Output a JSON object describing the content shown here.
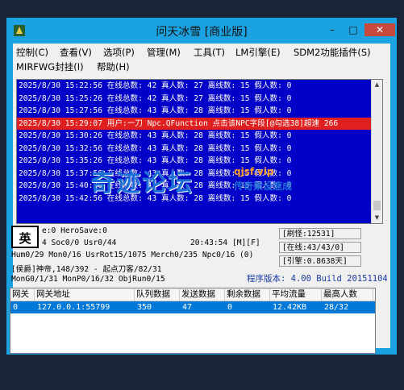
{
  "window": {
    "title": "问天冰雪 [商业版]",
    "minimize": "–",
    "maximize": "□",
    "close": "✕"
  },
  "menu": {
    "items": [
      "控制(C)",
      "查看(V)",
      "选项(P)",
      "管理(M)",
      "工具(T)",
      "LM引擎(E)",
      "SDM2功能插件(S)",
      "MIRFWG封挂(I)",
      "帮助(H)"
    ]
  },
  "log": {
    "lines": [
      "2025/8/30 15:22:56 在线总数: 42 真人数: 27 离线数: 15 假人数: 0",
      "2025/8/30 15:25:26 在线总数: 42 真人数: 27 离线数: 15 假人数: 0",
      "2025/8/30 15:27:56 在线总数: 43 真人数: 28 离线数: 15 假人数: 0",
      "2025/8/30 15:29:07 用户:一刀 Npc.QFunction 点击该NPC字段[@勾选38]超速 266",
      "2025/8/30 15:30:26 在线总数: 43 真人数: 28 离线数: 15 假人数: 0",
      "2025/8/30 15:32:56 在线总数: 43 真人数: 28 离线数: 15 假人数: 0",
      "2025/8/30 15:35:26 在线总数: 43 真人数: 28 离线数: 15 假人数: 0",
      "2025/8/30 15:37:56 在线总数: 43 真人数: 28 离线数: 15 假人数: 0",
      "2025/8/30 15:40:26 在线总数: 43 真人数: 28 离线数: 15 假人数: 0",
      "2025/8/30 15:42:56 在线总数: 43 真人数: 28 离线数: 15 假人数: 0"
    ]
  },
  "watermark": {
    "main": "奇迹论坛",
    "url": "qjsf.vip",
    "sub": "传奇架设速成"
  },
  "ime": "英",
  "status": {
    "line1": "e:0 HeroSave:0",
    "line2": "4 Soc0/0 Usr0/44",
    "time": "20:43:54 [M][F]",
    "line3": "Hum0/29 Mon0/16 UsrRot15/1075 Merch0/235 Npc0/16 (0)",
    "line4": "[侯爵]神帝,148/392 - 起点刀客/82/31",
    "line5": "MonG0/1/31 MonP0/16/32 ObjRun0/15"
  },
  "right_boxes": {
    "refresh": "[刷怪:12531]",
    "online": "[在线:43/43/0]",
    "engine": "[引擎:0.8638天]"
  },
  "version": "程序版本: 4.00 Build 20151104",
  "table": {
    "headers": [
      "网关",
      "网关地址",
      "队列数据",
      "发送数据",
      "剩余数据",
      "平均流量",
      "最高人数"
    ],
    "rows": [
      [
        "0",
        "127.0.0.1:55799",
        "350",
        "47",
        "0",
        "12.42KB",
        "28/32"
      ]
    ]
  },
  "colors": {
    "titlebar": "#1aa3e0",
    "log_bg": "#0000c8",
    "highlight": "#e0201e",
    "selected_row": "#0078d7"
  },
  "icons": [
    "app-icon",
    "minimize-icon",
    "maximize-icon",
    "close-icon",
    "scroll-up-icon",
    "scroll-down-icon"
  ]
}
